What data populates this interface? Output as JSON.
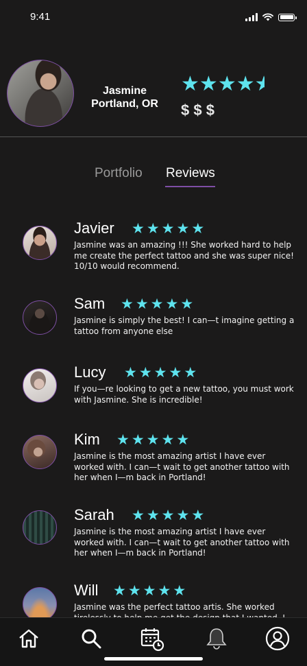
{
  "status_bar": {
    "time": "9:41"
  },
  "profile": {
    "name": "Jasmine",
    "location": "Portland, OR",
    "rating": 4.5,
    "price": "$ $ $"
  },
  "tabs": {
    "portfolio": "Portfolio",
    "reviews": "Reviews",
    "active": "Reviews"
  },
  "colors": {
    "accent_star": "#5ee3ee",
    "accent_purple": "#7f4ea6",
    "background": "#1b1a1a"
  },
  "reviews": [
    {
      "name": "Javier",
      "rating": 5,
      "text": "Jasmine was an amazing !!! She worked hard to help me create the perfect tattoo and she was super nice! 10/10 would recommend."
    },
    {
      "name": "Sam",
      "rating": 5,
      "text": "Jasmine is simply the best! I can—t imagine getting a tattoo from anyone else"
    },
    {
      "name": "Lucy",
      "rating": 5,
      "text": "If you—re looking to get a new tattoo, you must work with Jasmine. She is incredible!"
    },
    {
      "name": "Kim",
      "rating": 5,
      "text": "Jasmine is the most amazing artist I have ever worked with. I can—t wait to get another tattoo with her when I—m back in Portland!"
    },
    {
      "name": "Sarah",
      "rating": 5,
      "text": "Jasmine is the most amazing artist I have ever worked with. I can—t wait to get another tattoo with her when I—m back in Portland!"
    },
    {
      "name": "Will",
      "rating": 5,
      "text": "Jasmine was the perfect tattoo artis. She worked tirelessly to help me get the design that I wanted. I"
    }
  ],
  "nav": {
    "items": [
      {
        "icon": "home-icon"
      },
      {
        "icon": "search-icon"
      },
      {
        "icon": "calendar-icon"
      },
      {
        "icon": "bell-icon"
      },
      {
        "icon": "profile-icon"
      }
    ]
  }
}
